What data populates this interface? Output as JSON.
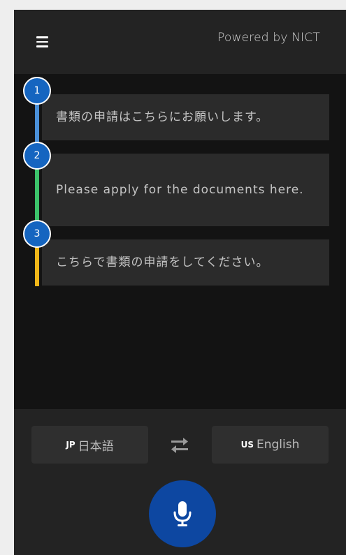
{
  "header": {
    "menu_icon": "hamburger-menu-icon",
    "powered_by": "Powered by NICT"
  },
  "messages": [
    {
      "number": "1",
      "text": "書類の申請はこちらにお願いします。",
      "color": "#4a90d9"
    },
    {
      "number": "2",
      "text": "Please apply for the documents here.",
      "color": "#3cc36b"
    },
    {
      "number": "3",
      "text": "こちらで書類の申請をしてください。",
      "color": "#f0b619"
    }
  ],
  "language_bar": {
    "source": {
      "code": "JP",
      "label": "日本語"
    },
    "swap_icon": "swap-arrows-icon",
    "target": {
      "code": "US",
      "label": "English"
    }
  },
  "mic_button": {
    "icon": "microphone-icon",
    "color": "#0d47a1"
  },
  "colors": {
    "badge": "#1565c0",
    "background": "#131313",
    "bubble": "#2b2b2b"
  }
}
